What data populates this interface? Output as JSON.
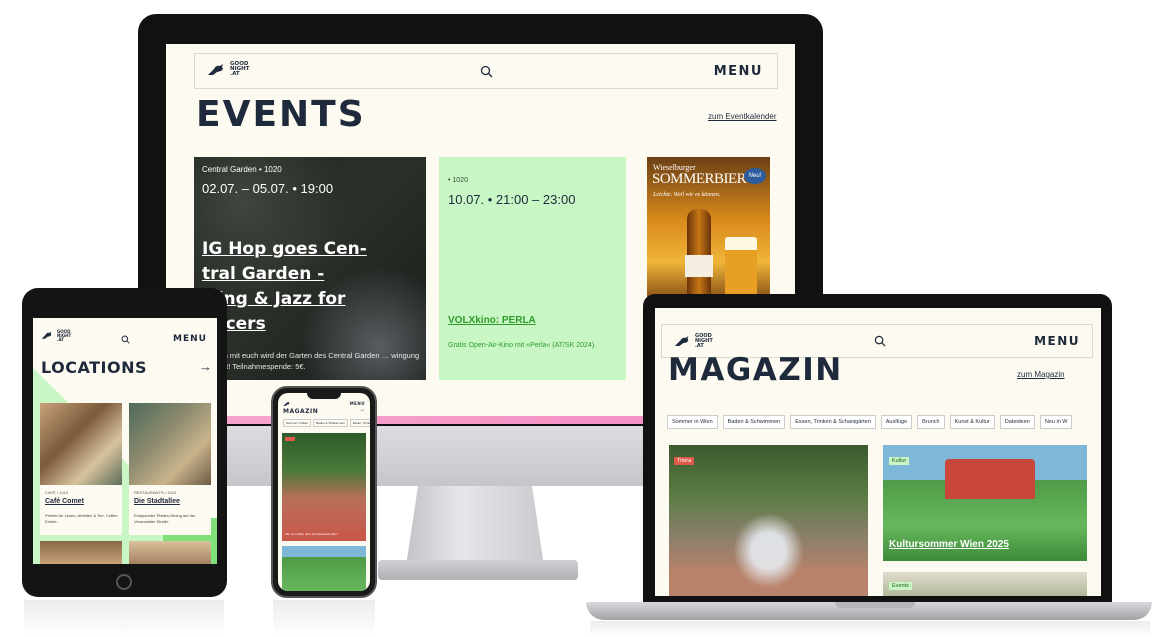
{
  "brand": {
    "logo_line1": "GOOD",
    "logo_line2": "NIGHT",
    "logo_line3": ".AT",
    "menu_label": "MENU",
    "navy": "#1e2a3c",
    "cream": "#fdfbf1",
    "accent_green": "#c8f7c5",
    "link_green": "#2e9b2a"
  },
  "monitor": {
    "page_title": "EVENTS",
    "calendar_link": "zum Eventkalender",
    "event1": {
      "venue": "Central Garden • 1020",
      "dates": "02.07. – 05.07. • 19:00",
      "title": "IG Hop goes Central Garden - Swing & Jazz for Dancers",
      "title_visible": "IG Hop goes Cen-\ntral Garden -\nwing & Jazz for\nancers",
      "teaser": "…nsam mit euch wird der Garten des Central Garden … wingung versetzt! Teilnahmespende: 5€."
    },
    "event2": {
      "district": "• 1020",
      "time": "10.07. • 21:00 – 23:00",
      "title": "VOLXkino: PERLA",
      "teaser": "Gratis Open-Air-Kino mit »Perla« (AT/SK 2024)."
    },
    "ad": {
      "brand": "Wieselburger",
      "headline": "SOMMERBIER",
      "badge": "Neu!",
      "tagline": "Leichte. Weil wir es können."
    }
  },
  "laptop": {
    "page_title": "MAGAZIN",
    "magazin_link": "zum Magazin",
    "filter_chips": [
      "Sommer in Wien",
      "Baden & Schwimmen",
      "Essen, Trinken & Schanigärten",
      "Ausflüge",
      "Brunch",
      "Kunst & Kultur",
      "Dateideen",
      "Neu in W"
    ],
    "card1_tag": "Triera",
    "card2_tag": "Kultur",
    "card2_title": "Kultursommer Wien 2025",
    "card3_tag": "Events"
  },
  "tablet": {
    "page_title": "LOCATIONS",
    "arrow": "→",
    "loc1": {
      "category": "CAFÉ • 1010",
      "name": "Café Comet",
      "teaser": "Perfekt für Lesen, Arbeiten & Tee. Coffee Erlebe."
    },
    "loc2": {
      "category": "RESTAURANTS • 1020",
      "name": "Die Stadtallee",
      "teaser": "Entspannter Platten-Dining auf der Veranstalter Straße."
    }
  },
  "phone": {
    "page_title": "MAGAZIN",
    "menu_label": "MENU",
    "arrow": "→",
    "chips": [
      "Sommer in Wien",
      "Baden & Schwimmen",
      "Essen, Trinken & Schani"
    ],
    "card_caption": "Alle zum Wien Jazz Orchesterfest Wien"
  }
}
